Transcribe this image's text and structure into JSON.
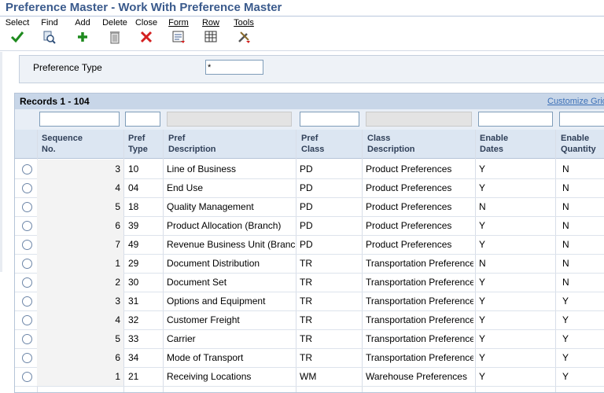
{
  "window": {
    "title": "Preference Master - Work With Preference Master"
  },
  "toolbar": {
    "select": "Select",
    "find": "Find",
    "add": "Add",
    "delete": "Delete",
    "close": "Close",
    "form": "Form",
    "row": "Row",
    "tools": "Tools"
  },
  "criteria": {
    "preference_type_label": "Preference Type",
    "preference_type_value": "*"
  },
  "grid": {
    "records_label": "Records 1 - 104",
    "customize_label": "Customize Grid",
    "columns": {
      "sequence_no": [
        "Sequence",
        "No."
      ],
      "pref_type": [
        "Pref",
        "Type"
      ],
      "pref_description": [
        "Pref",
        "Description"
      ],
      "pref_class": [
        "Pref",
        "Class"
      ],
      "class_description": [
        "Class",
        "Description"
      ],
      "enable_dates": [
        "Enable",
        "Dates"
      ],
      "enable_quantity": [
        "Enable",
        "Quantity"
      ]
    },
    "rows": [
      [
        "3",
        "10",
        "Line of Business",
        "PD",
        "Product Preferences",
        "Y",
        "N"
      ],
      [
        "4",
        "04",
        "End Use",
        "PD",
        "Product Preferences",
        "Y",
        "N"
      ],
      [
        "5",
        "18",
        "Quality Management",
        "PD",
        "Product Preferences",
        "N",
        "N"
      ],
      [
        "6",
        "39",
        "Product Allocation (Branch)",
        "PD",
        "Product Preferences",
        "Y",
        "N"
      ],
      [
        "7",
        "49",
        "Revenue Business Unit (Branch",
        "PD",
        "Product Preferences",
        "Y",
        "N"
      ],
      [
        "1",
        "29",
        "Document Distribution",
        "TR",
        "Transportation Preferences",
        "N",
        "N"
      ],
      [
        "2",
        "30",
        "Document Set",
        "TR",
        "Transportation Preferences",
        "Y",
        "N"
      ],
      [
        "3",
        "31",
        "Options and Equipment",
        "TR",
        "Transportation Preferences",
        "Y",
        "Y"
      ],
      [
        "4",
        "32",
        "Customer Freight",
        "TR",
        "Transportation Preferences",
        "Y",
        "Y"
      ],
      [
        "5",
        "33",
        "Carrier",
        "TR",
        "Transportation Preferences",
        "Y",
        "Y"
      ],
      [
        "6",
        "34",
        "Mode of Transport",
        "TR",
        "Transportation Preferences",
        "Y",
        "Y"
      ],
      [
        "1",
        "21",
        "Receiving Locations",
        "WM",
        "Warehouse Preferences",
        "Y",
        "Y"
      ]
    ]
  },
  "icons": {
    "select": "checkmark-icon",
    "find": "binoculars-icon",
    "add": "plus-icon",
    "delete": "trash-icon",
    "close": "x-icon",
    "form": "form-icon",
    "row": "grid-icon",
    "tools": "tools-icon"
  },
  "colors": {
    "title": "#3a5a8c",
    "accent_green": "#1e8a1e",
    "close_red": "#d42020"
  }
}
